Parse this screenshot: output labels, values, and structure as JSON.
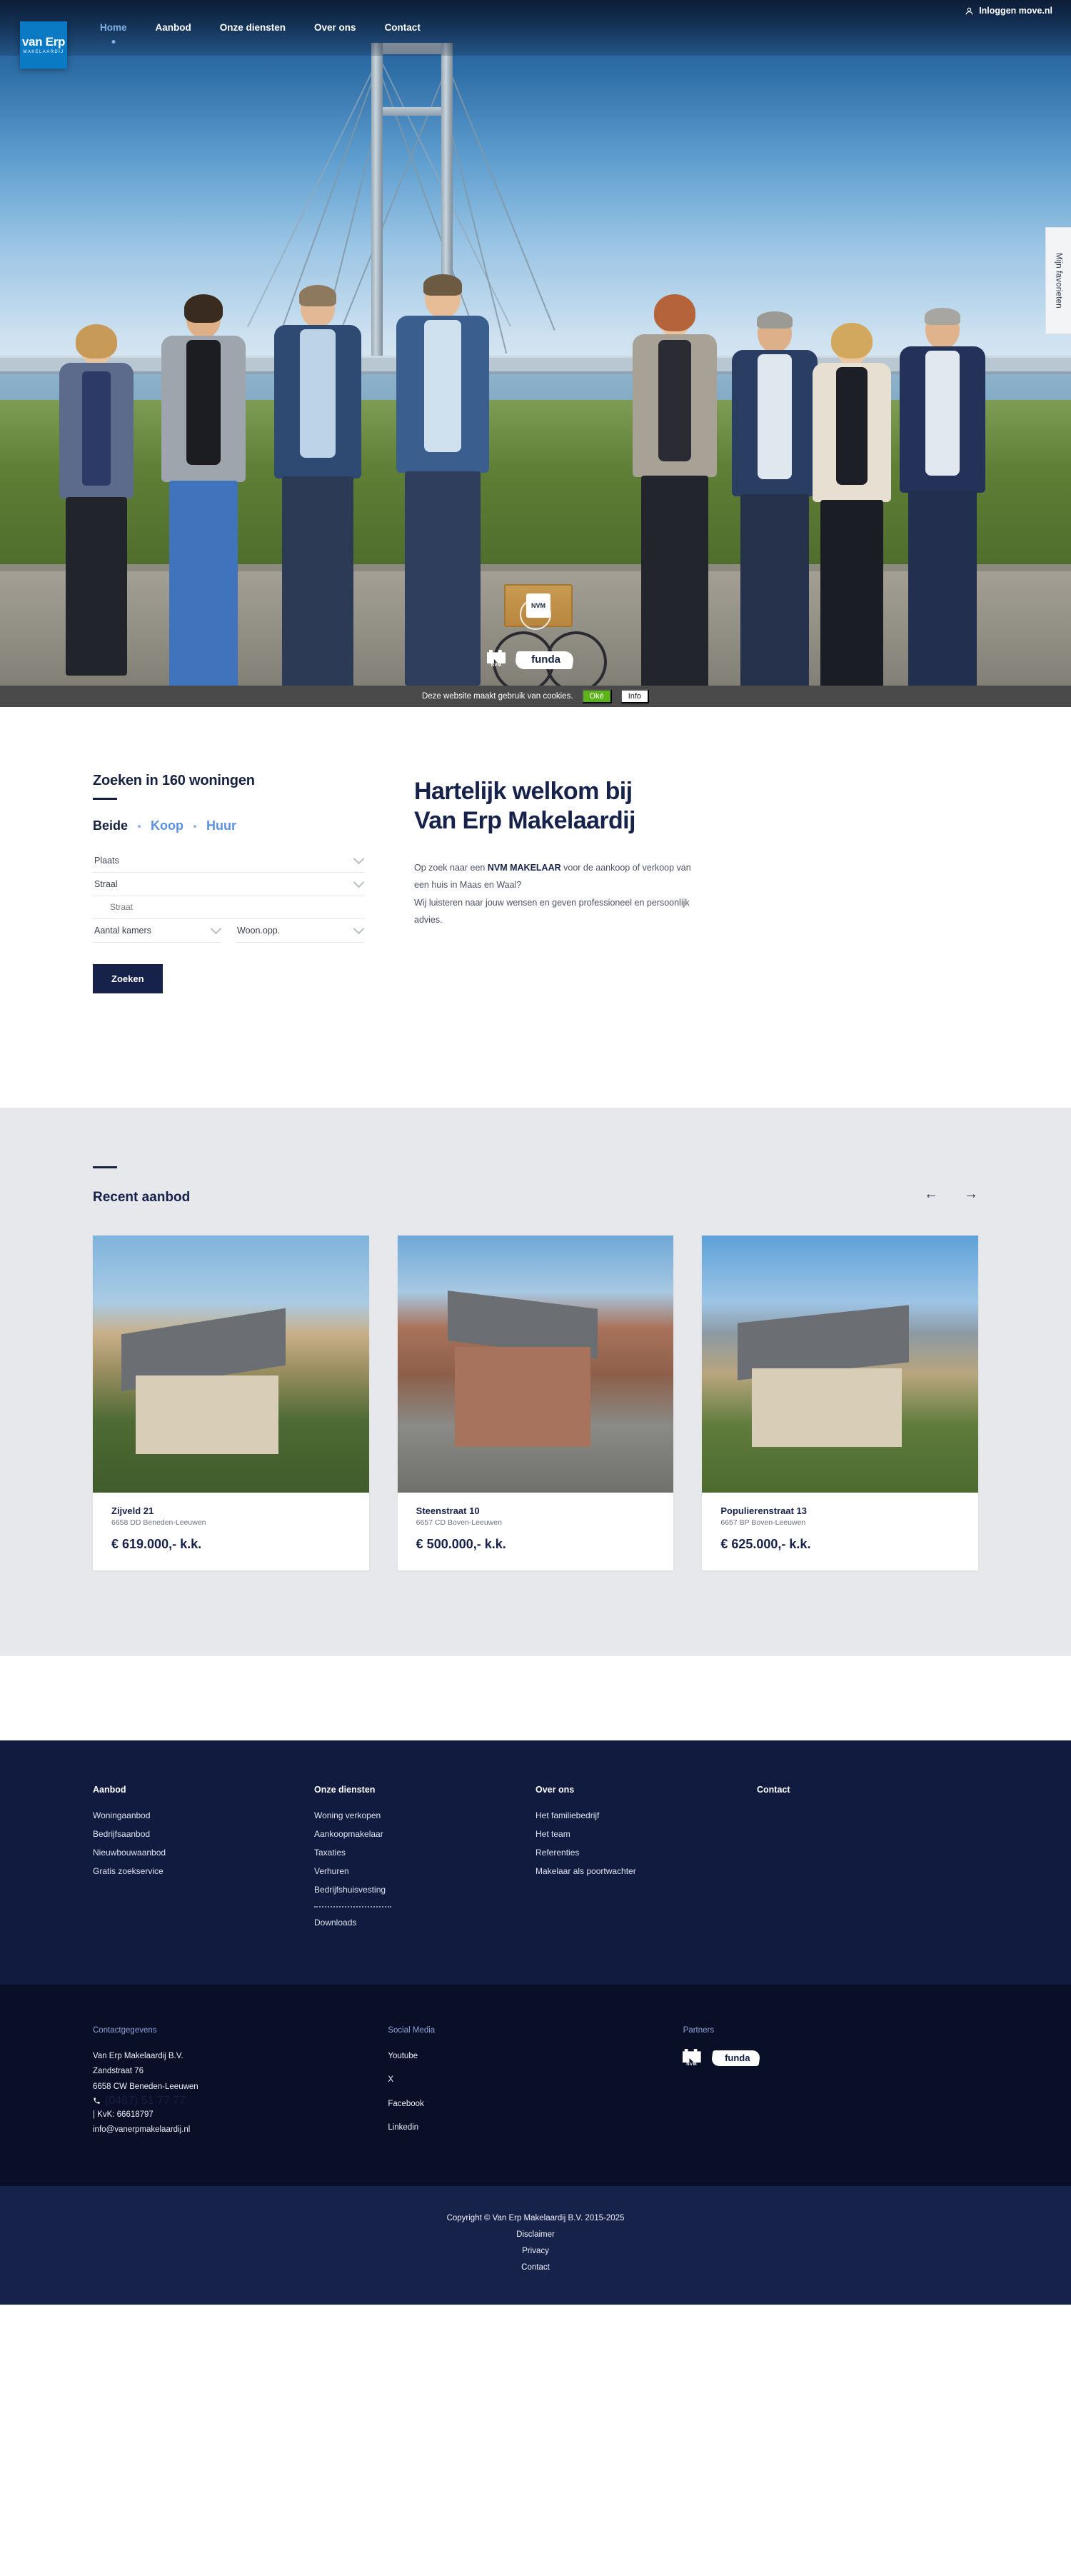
{
  "brand": {
    "logo_main": "van Erp",
    "logo_sub": "MAKELAARDIJ"
  },
  "header": {
    "nav": [
      {
        "label": "Home",
        "active": true
      },
      {
        "label": "Aanbod",
        "active": false
      },
      {
        "label": "Onze diensten",
        "active": false
      },
      {
        "label": "Over ons",
        "active": false
      },
      {
        "label": "Contact",
        "active": false
      }
    ],
    "login_label": "Inloggen move.nl",
    "login_icon": "user-icon",
    "favorites_tab": "Mijn favorieten"
  },
  "hero": {
    "scroll_icon": "chevron-down-icon",
    "badges": [
      {
        "name": "nvm-logo",
        "label": "NVM"
      },
      {
        "name": "funda-logo",
        "label": "funda"
      }
    ]
  },
  "cookies": {
    "message": "Deze website maakt gebruik van cookies.",
    "accept_label": "Oké",
    "info_label": "Info"
  },
  "search": {
    "title": "Zoeken in 160 woningen",
    "listing_count": 160,
    "tabs": [
      {
        "label": "Beide",
        "active": true
      },
      {
        "label": "Koop",
        "active": false
      },
      {
        "label": "Huur",
        "active": false
      }
    ],
    "fields": [
      {
        "label": "Plaats",
        "type": "select",
        "icon": "chevron-down-icon"
      },
      {
        "label": "Straal",
        "type": "select",
        "icon": "chevron-down-icon"
      }
    ],
    "street_placeholder": "Straat",
    "rooms_label": "Aantal kamers",
    "area_label": "Woon.opp.",
    "submit_label": "Zoeken"
  },
  "welcome": {
    "heading_line1": "Hartelijk welkom bij",
    "heading_line2": "Van Erp Makelaardij",
    "body_1": "Op zoek naar een ",
    "body_bold": "NVM MAKELAAR",
    "body_2": " voor de aankoop of verkoop van een huis in Maas en Waal?",
    "body_3": "Wij luisteren naar jouw wensen en geven professioneel en persoonlijk advies."
  },
  "recent": {
    "title": "Recent aanbod",
    "prev_icon": "arrow-left-icon",
    "next_icon": "arrow-right-icon",
    "cards": [
      {
        "address": "Zijveld 21",
        "zip": "6658 DD Beneden-Leeuwen",
        "price": "€ 619.000,- k.k."
      },
      {
        "address": "Steenstraat 10",
        "zip": "6657 CD Boven-Leeuwen",
        "price": "€ 500.000,- k.k."
      },
      {
        "address": "Populierenstraat 13",
        "zip": "6657 BP Boven-Leeuwen",
        "price": "€ 625.000,- k.k."
      }
    ]
  },
  "footer": {
    "columns": [
      {
        "title": "Aanbod",
        "links": [
          "Woningaanbod",
          "Bedrijfsaanbod",
          "Nieuwbouwaanbod",
          "Gratis zoekservice"
        ]
      },
      {
        "title": "Onze diensten",
        "links": [
          "Woning verkopen",
          "Aankoopmakelaar",
          "Taxaties",
          "Verhuren",
          "Bedrijfshuisvesting"
        ],
        "extra": [
          "Downloads"
        ]
      },
      {
        "title": "Over ons",
        "links": [
          "Het familiebedrijf",
          "Het team",
          "Referenties",
          "Makelaar als poortwachter"
        ]
      },
      {
        "title": "Contact",
        "links": []
      }
    ],
    "contact": {
      "title": "Contactgegevens",
      "company": "Van Erp Makelaardij B.V.",
      "street": "Zandstraat 76",
      "city": "6658 CW Beneden-Leeuwen",
      "phone": "(0487) 51 77 77",
      "phone_icon": "phone-icon",
      "kvk": "| KvK: 66618797",
      "email": "info@vanerpmakelaardij.nl"
    },
    "social": {
      "title": "Social Media",
      "links": [
        "Youtube",
        "X",
        "Facebook",
        "Linkedin"
      ]
    },
    "partners": {
      "title": "Partners",
      "logos": [
        {
          "name": "nvm-logo",
          "label": "NVM"
        },
        {
          "name": "funda-logo",
          "label": "funda"
        }
      ]
    },
    "copyright": "Copyright © Van Erp Makelaardij B.V. 2015-2025",
    "legal": [
      "Disclaimer",
      "Privacy",
      "Contact"
    ]
  }
}
